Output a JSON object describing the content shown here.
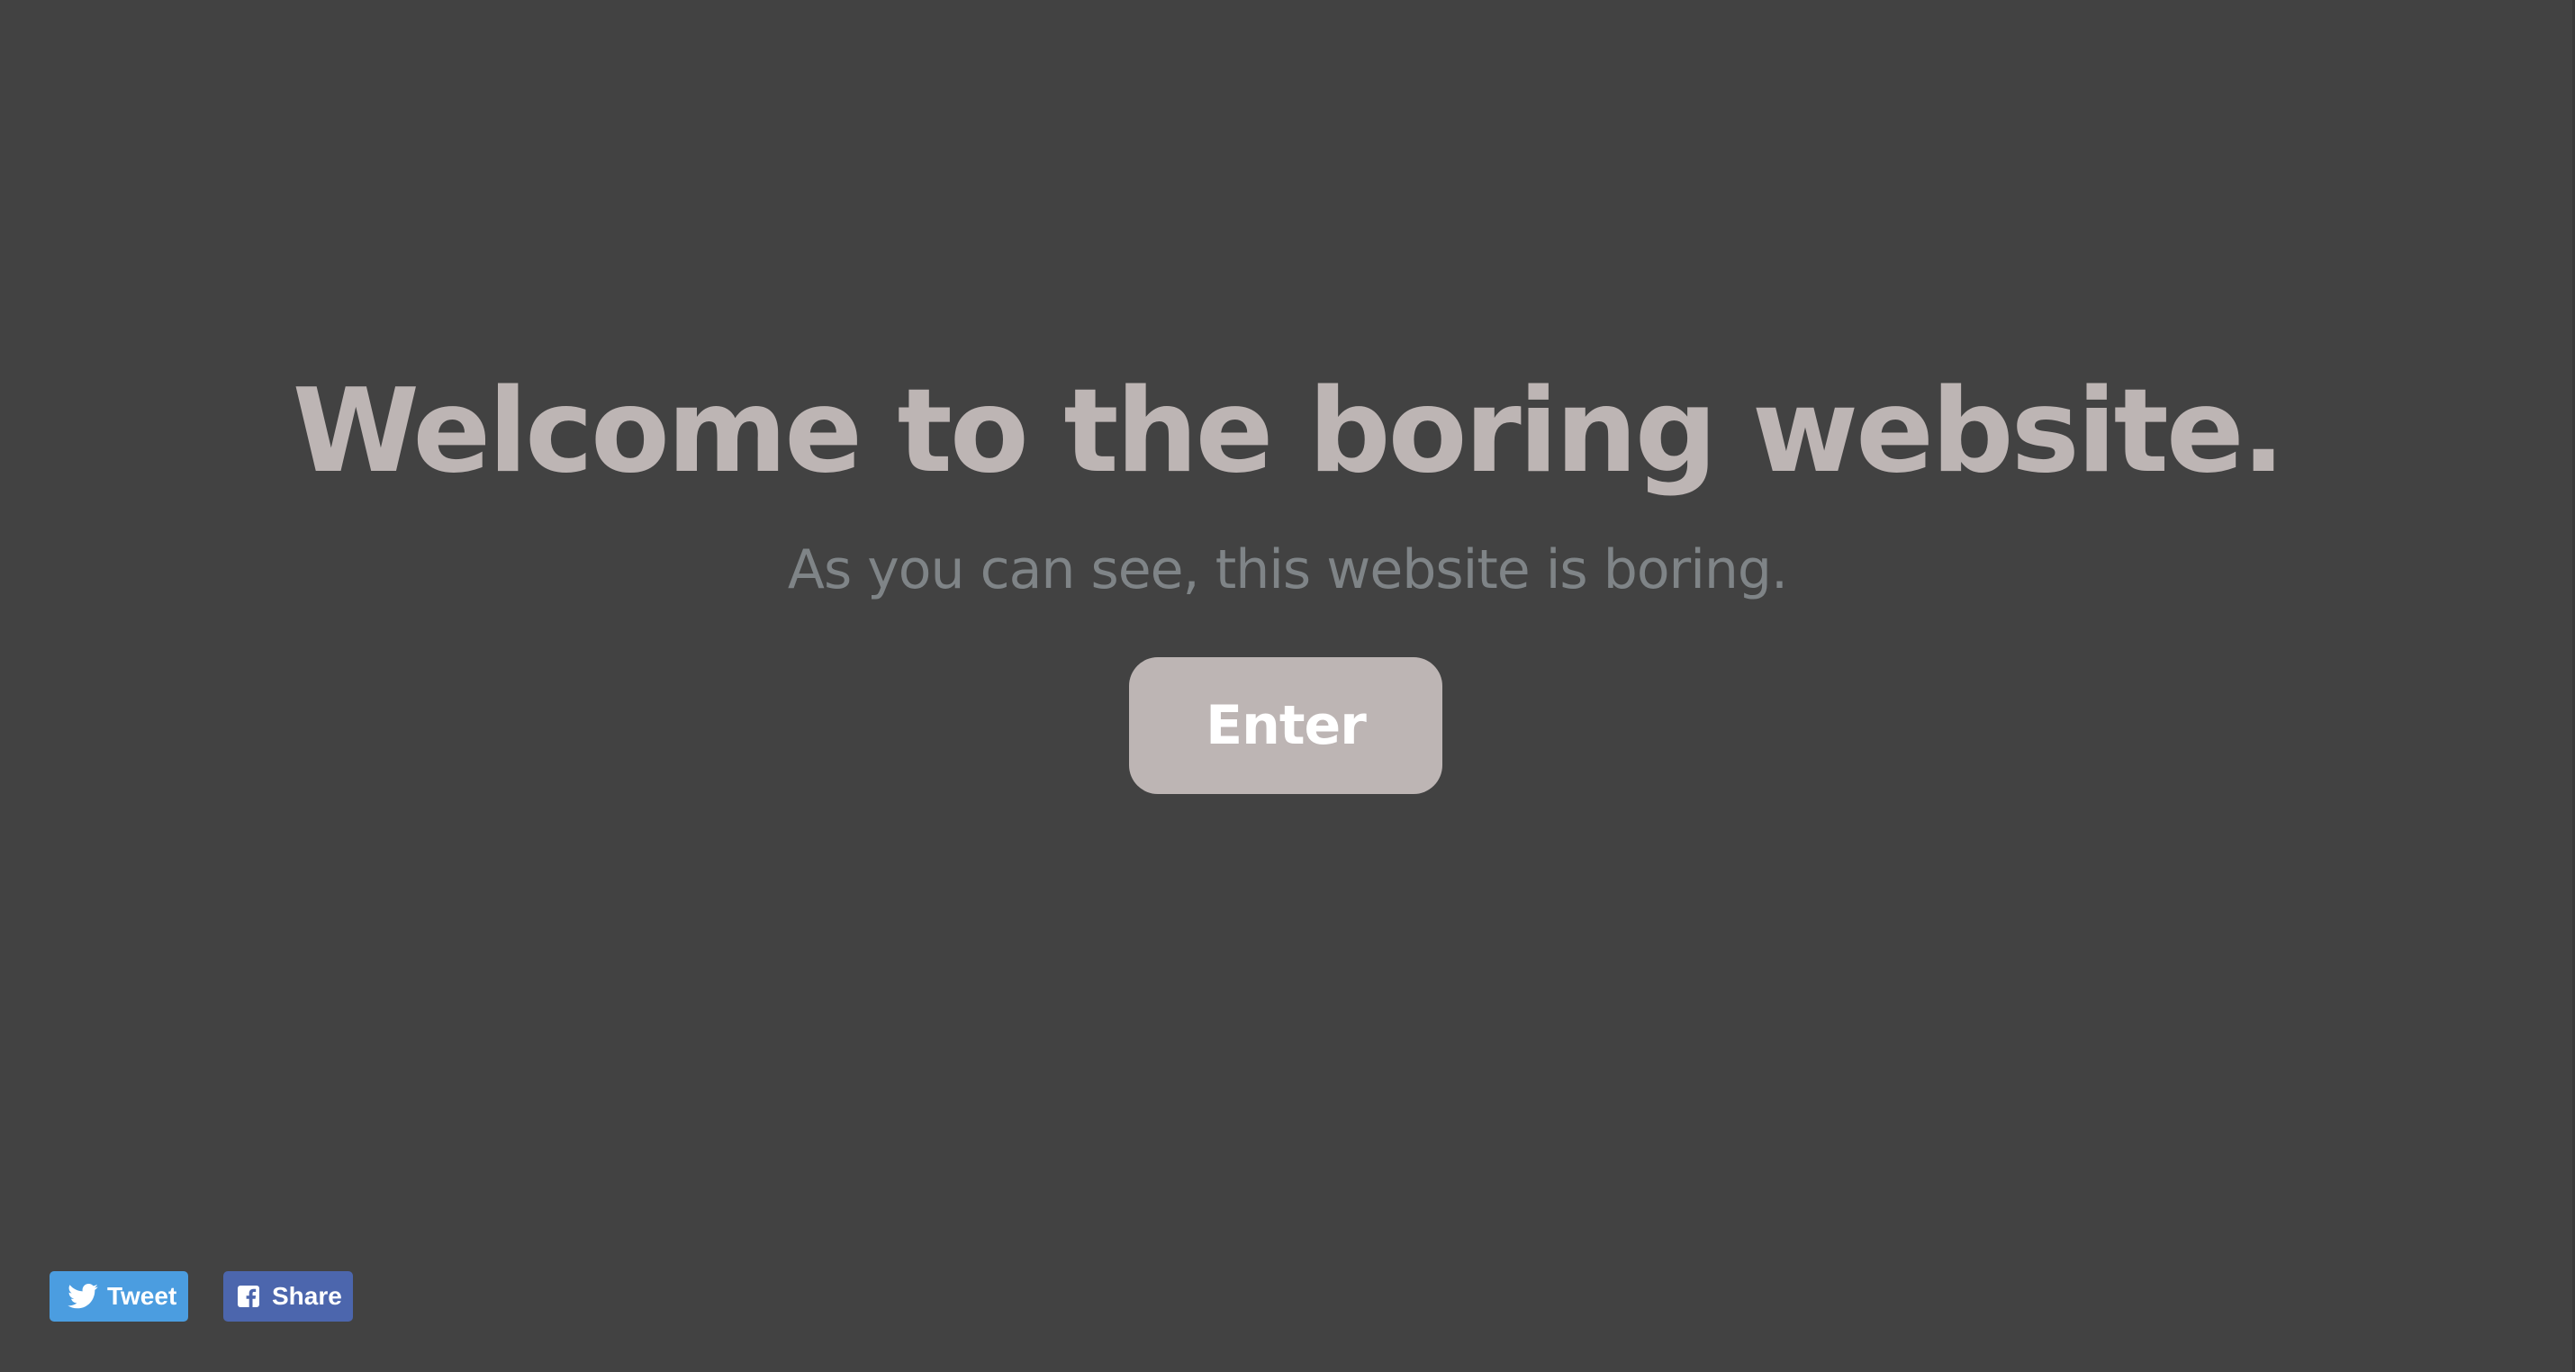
{
  "hero": {
    "headline": "Welcome to the boring website.",
    "subhead": "As you can see, this website is boring.",
    "enter_label": "Enter"
  },
  "social": {
    "tweet_label": "Tweet",
    "tweet_icon": "twitter-bird-icon",
    "share_label": "Share",
    "share_icon": "facebook-icon"
  },
  "colors": {
    "background": "#424242",
    "headline": "#bdb5b4",
    "subhead": "#7f8487",
    "button_bg": "#bdb5b4",
    "button_text": "#ffffff",
    "twitter": "#4b9de0",
    "facebook": "#4c66ad"
  }
}
